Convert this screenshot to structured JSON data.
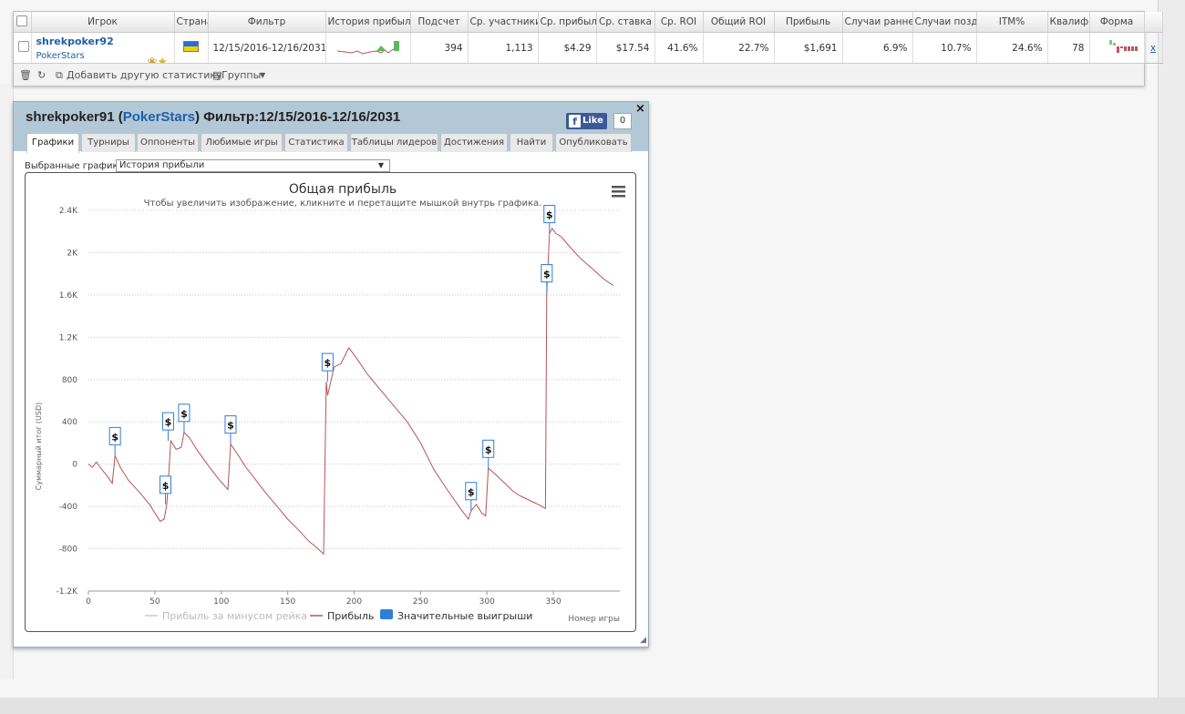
{
  "stats_table": {
    "headers": [
      "Игрок",
      "Страна",
      "Фильтр",
      "История прибыли",
      "Подсчет",
      "Ср. участники",
      "Ср. прибыль",
      "Ср. ставка",
      "Ср. ROI",
      "Общий ROI",
      "Прибыль",
      "Случаи ранней",
      "Случаи поздней",
      "ITM%",
      "Квалификация",
      "Форма"
    ],
    "row": {
      "player": "shrekpoker92",
      "network": "PokerStars",
      "filter": "12/15/2016-12/16/2031",
      "count": "394",
      "avg_entrants": "1,113",
      "avg_profit": "$4.29",
      "avg_stake": "$17.54",
      "avg_roi": "41.6%",
      "total_roi": "22.7%",
      "profit": "$1,691",
      "early_finish": "6.9%",
      "late_finish": "10.7%",
      "itm": "24.6%",
      "qualifier": "78",
      "remove": "x"
    },
    "toolbar": {
      "add_stat": "Добавить другую статистику",
      "groups": "Группы"
    }
  },
  "panel": {
    "player": "shrekpoker91",
    "site": "PokerStars",
    "filter_label": "Фильтр:",
    "filter": "12/15/2016-12/16/2031",
    "like_label": "Like",
    "like_count": "0",
    "close": "×",
    "tabs": [
      "Графики",
      "Турниры",
      "Оппоненты",
      "Любимые игры",
      "Статистика",
      "Таблицы лидеров",
      "Достижения",
      "Найти",
      "Опубликовать"
    ],
    "selected_label": "Выбранные графики:",
    "selected_value": "История прибыли"
  },
  "colors": {
    "profit_line": "#b5545a",
    "rake_line": "#cccccc",
    "marker": "#2f7ed8",
    "panel_head": "#b3c8d7"
  },
  "chart_data": {
    "type": "line",
    "title": "Общая прибыль",
    "subtitle": "Чтобы увеличить изображение, кликните и перетащите мышкой внутрь графика.",
    "ylabel": "Суммарный итог (USD)",
    "xlabel": "Номер игры",
    "xlim": [
      0,
      400
    ],
    "ylim": [
      -1200,
      2400
    ],
    "x_ticks": [
      0,
      50,
      100,
      150,
      200,
      250,
      300,
      350
    ],
    "y_ticks": [
      -1200,
      -800,
      -400,
      0,
      400,
      800,
      1200,
      1600,
      2000,
      2400
    ],
    "y_tick_labels": [
      "-1.2K",
      "-800",
      "-400",
      "0",
      "400",
      "800",
      "1.2K",
      "1.6K",
      "2K",
      "2.4K"
    ],
    "grid": true,
    "legend": [
      "Прибыль за минусом рейка",
      "Прибыль",
      "Значительные выигрыши"
    ],
    "series": [
      {
        "name": "Прибыль",
        "x": [
          0,
          3,
          6,
          10,
          14,
          18,
          20,
          24,
          30,
          38,
          46,
          54,
          57,
          59,
          62,
          66,
          70,
          72,
          76,
          82,
          90,
          98,
          105,
          107,
          112,
          118,
          126,
          134,
          142,
          150,
          158,
          166,
          172,
          177,
          179,
          180,
          185,
          190,
          196,
          202,
          210,
          220,
          230,
          240,
          250,
          260,
          270,
          280,
          286,
          288,
          292,
          296,
          299,
          301,
          305,
          310,
          315,
          320,
          325,
          330,
          335,
          340,
          344,
          345,
          346,
          347,
          349,
          352,
          356,
          362,
          370,
          380,
          388,
          395
        ],
        "y": [
          0,
          -30,
          20,
          -50,
          -110,
          -180,
          80,
          -30,
          -150,
          -260,
          -380,
          -540,
          -520,
          -380,
          220,
          140,
          160,
          300,
          250,
          130,
          -10,
          -140,
          -240,
          190,
          100,
          -20,
          -150,
          -280,
          -400,
          -520,
          -620,
          -730,
          -790,
          -850,
          780,
          650,
          920,
          950,
          1100,
          1000,
          850,
          700,
          550,
          400,
          200,
          -50,
          -240,
          -420,
          -520,
          -440,
          -380,
          -460,
          -490,
          -40,
          -80,
          -140,
          -200,
          -260,
          -300,
          -330,
          -360,
          -390,
          -420,
          1620,
          1900,
          2180,
          2230,
          2180,
          2150,
          2060,
          1950,
          1840,
          1750,
          1690
        ]
      }
    ],
    "significant_wins": [
      {
        "x": 20,
        "y": 80,
        "label": "$"
      },
      {
        "x": 58,
        "y": -380,
        "label": "$"
      },
      {
        "x": 60,
        "y": 220,
        "label": "$"
      },
      {
        "x": 72,
        "y": 300,
        "label": "$"
      },
      {
        "x": 107,
        "y": 190,
        "label": "$"
      },
      {
        "x": 180,
        "y": 780,
        "label": "$"
      },
      {
        "x": 288,
        "y": -440,
        "label": "$"
      },
      {
        "x": 301,
        "y": -40,
        "label": "$"
      },
      {
        "x": 345,
        "y": 1620,
        "label": "$"
      },
      {
        "x": 347,
        "y": 2180,
        "label": "$"
      }
    ]
  }
}
